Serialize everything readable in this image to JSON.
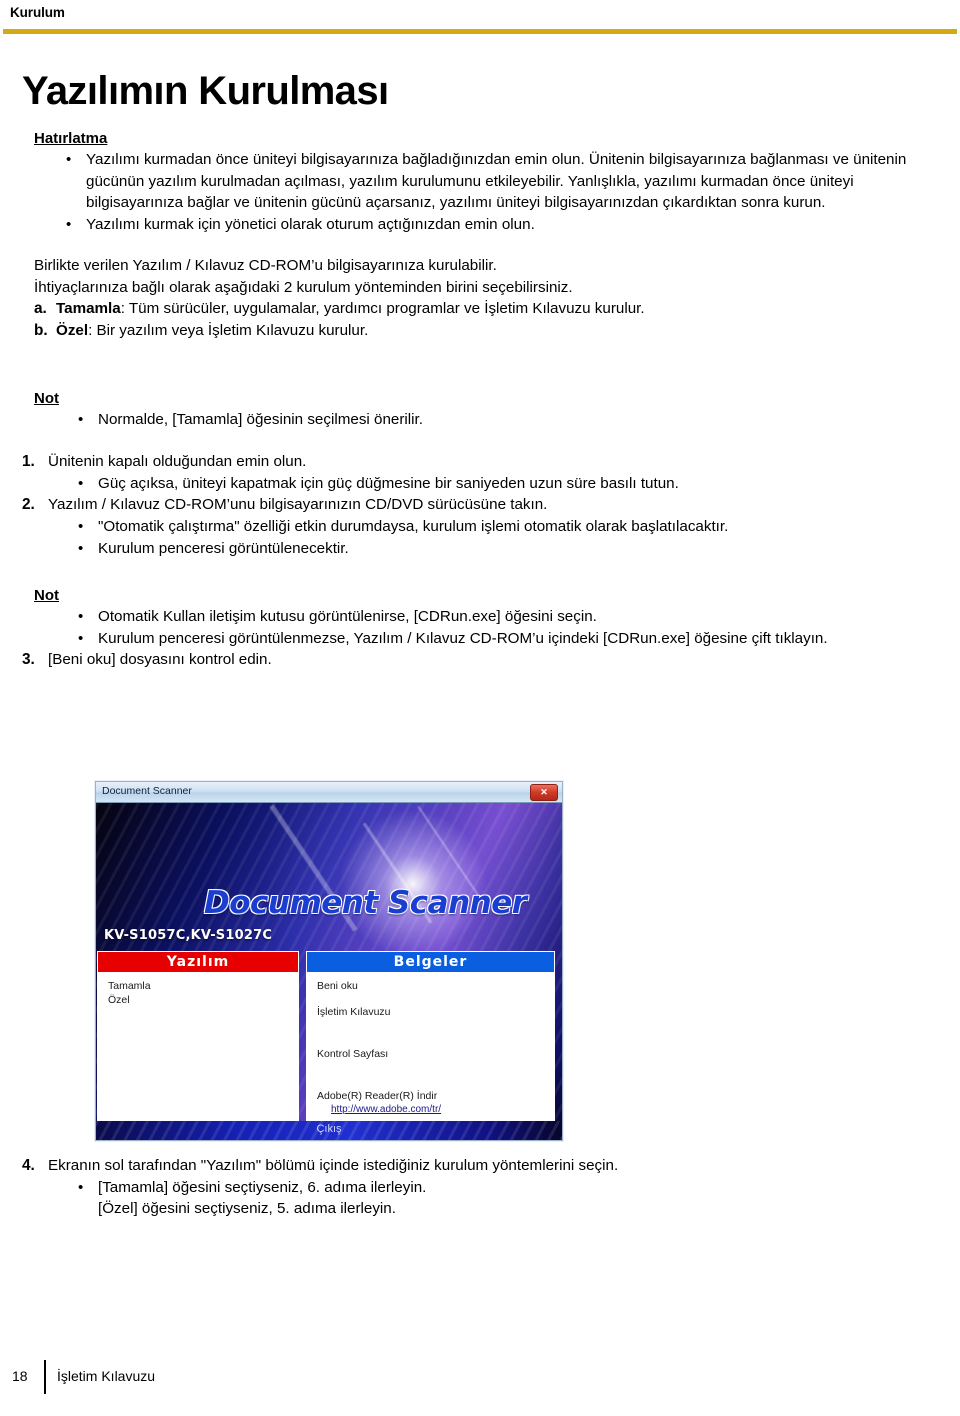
{
  "header": {
    "running_title": "Kurulum",
    "rule_color": "#d3aa14"
  },
  "title": "Yazılımın Kurulması",
  "reminder": {
    "heading": "Hatırlatma",
    "bullets": [
      "Yazılımı kurmadan önce üniteyi bilgisayarınıza bağladığınızdan emin olun. Ünitenin bilgisayarınıza bağlanması ve ünitenin gücünün yazılım kurulmadan açılması, yazılım kurulumunu etkileyebilir. Yanlışlıkla, yazılımı kurmadan önce üniteyi bilgisayarınıza bağlar ve ünitenin gücünü açarsanız, yazılımı üniteyi bilgisayarınızdan çıkardıktan sonra kurun.",
      "Yazılımı kurmak için yönetici olarak oturum açtığınızdan emin olun."
    ]
  },
  "intro": {
    "line1": "Birlikte verilen Yazılım / Kılavuz CD-ROM’u bilgisayarınıza kurulabilir.",
    "line2": "İhtiyaçlarınıza bağlı olarak aşağıdaki 2 kurulum yönteminden birini seçebilirsiniz.",
    "options": [
      {
        "marker": "a.",
        "name": "Tamamla",
        "rest": ": Tüm sürücüler, uygulamalar, yardımcı programlar ve İşletim Kılavuzu kurulur."
      },
      {
        "marker": "b.",
        "name": "Özel",
        "rest": ": Bir yazılım veya İşletim Kılavuzu kurulur."
      }
    ]
  },
  "note1": {
    "heading": "Not",
    "bullets": [
      "Normalde, [Tamamla] öğesinin seçilmesi önerilir."
    ]
  },
  "steps": [
    {
      "marker": "1.",
      "text": "Ünitenin kapalı olduğundan emin olun.",
      "bullets": [
        "Güç açıksa, üniteyi kapatmak için güç düğmesine bir saniyeden uzun süre basılı tutun."
      ]
    },
    {
      "marker": "2.",
      "text": "Yazılım / Kılavuz CD-ROM’unu bilgisayarınızın CD/DVD sürücüsüne takın.",
      "bullets": [
        "\"Otomatik çalıştırma\" özelliği etkin durumdaysa, kurulum işlemi otomatik olarak başlatılacaktır.",
        "Kurulum penceresi görüntülenecektir."
      ]
    }
  ],
  "note2": {
    "heading": "Not",
    "bullets": [
      "Otomatik Kullan iletişim kutusu görüntülenirse, [CDRun.exe] öğesini seçin.",
      "Kurulum penceresi görüntülenmezse, Yazılım / Kılavuz CD-ROM’u içindeki [CDRun.exe] öğesine çift tıklayın."
    ]
  },
  "step3": {
    "marker": "3.",
    "text": "[Beni oku] dosyasını kontrol edin."
  },
  "screenshot": {
    "window_title": "Document Scanner",
    "close_label": "✕",
    "brand_wordmark": "Document Scanner",
    "model_numbers": "KV-S1057C,KV-S1027C",
    "panel_software": {
      "header": "Yazılım",
      "items": [
        "Tamamla",
        "Özel"
      ]
    },
    "panel_documents": {
      "header": "Belgeler",
      "items": [
        "Beni oku",
        "İşletim Kılavuzu",
        "Kontrol Sayfası",
        "Adobe(R) Reader(R) İndir"
      ],
      "link": "http://www.adobe.com/tr/"
    },
    "exit_label": "Çıkış",
    "colors": {
      "software_header": "#e60000",
      "documents_header": "#0a5fe0"
    }
  },
  "step4": {
    "marker": "4.",
    "text": "Ekranın sol tarafından \"Yazılım\" bölümü içinde istediğiniz kurulum yöntemlerini seçin.",
    "bullets": [
      "[Tamamla] öğesini seçtiyseniz, 6. adıma ilerleyin.",
      "[Özel] öğesini seçtiyseniz, 5. adıma ilerleyin."
    ]
  },
  "footer": {
    "page_number": "18",
    "document_title": "İşletim Kılavuzu"
  }
}
